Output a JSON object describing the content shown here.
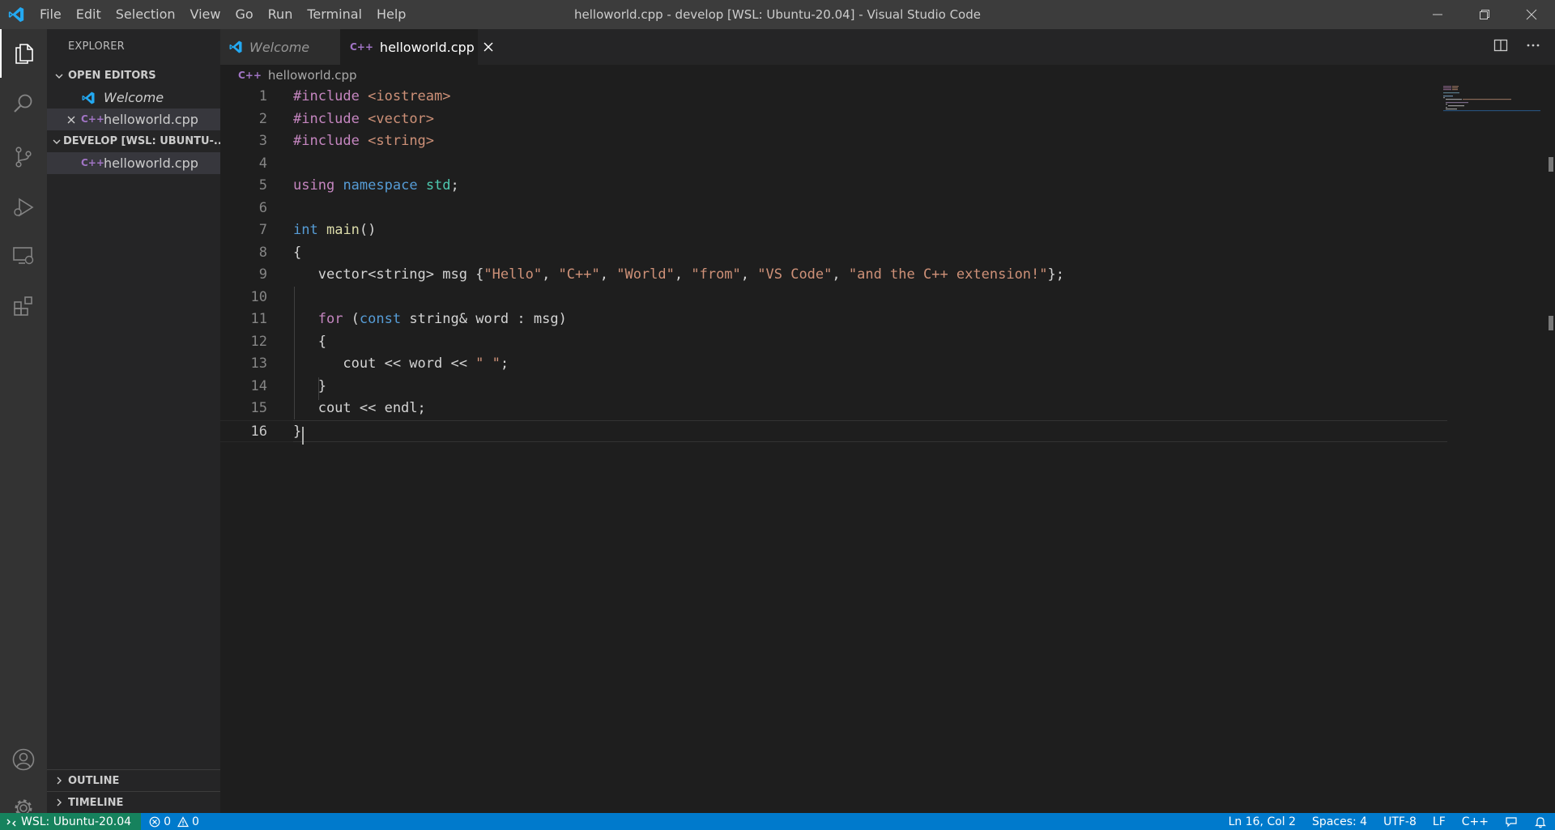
{
  "window": {
    "title": "helloworld.cpp - develop [WSL: Ubuntu-20.04] - Visual Studio Code",
    "app_icon": "vscode-logo"
  },
  "menu": [
    "File",
    "Edit",
    "Selection",
    "View",
    "Go",
    "Run",
    "Terminal",
    "Help"
  ],
  "activity_bar": [
    "files-icon",
    "search-icon",
    "source-control-icon",
    "run-debug-icon",
    "remote-explorer-icon",
    "extensions-icon",
    "account-icon",
    "settings-gear-icon"
  ],
  "sidebar": {
    "title": "EXPLORER",
    "open_editors": {
      "header": "OPEN EDITORS",
      "items": [
        {
          "label": "Welcome",
          "icon": "vscode-logo"
        },
        {
          "label": "helloworld.cpp",
          "icon": "cpp-file-icon"
        }
      ]
    },
    "workspace": {
      "header": "DEVELOP [WSL: UBUNTU-...",
      "items": [
        {
          "label": "helloworld.cpp",
          "icon": "cpp-file-icon"
        }
      ]
    },
    "outline": "OUTLINE",
    "timeline": "TIMELINE"
  },
  "tabs": [
    {
      "label": "Welcome",
      "active": false
    },
    {
      "label": "helloworld.cpp",
      "active": true
    }
  ],
  "breadcrumb": "helloworld.cpp",
  "code": {
    "line_numbers": [
      "1",
      "2",
      "3",
      "4",
      "5",
      "6",
      "7",
      "8",
      "9",
      "10",
      "11",
      "12",
      "13",
      "14",
      "15",
      "16"
    ],
    "current_line": 16
  },
  "status": {
    "remote": "WSL: Ubuntu-20.04",
    "errors": "0",
    "warnings": "0",
    "position": "Ln 16, Col 2",
    "spaces": "Spaces: 4",
    "encoding": "UTF-8",
    "eol": "LF",
    "language": "C++"
  },
  "colors": {
    "accent": "#007acc",
    "remote": "#16825d",
    "keyword": "#569cd6",
    "preprocessor": "#c586c0",
    "string": "#ce9178",
    "type": "#4ec9b0",
    "function": "#dcdcaa"
  }
}
